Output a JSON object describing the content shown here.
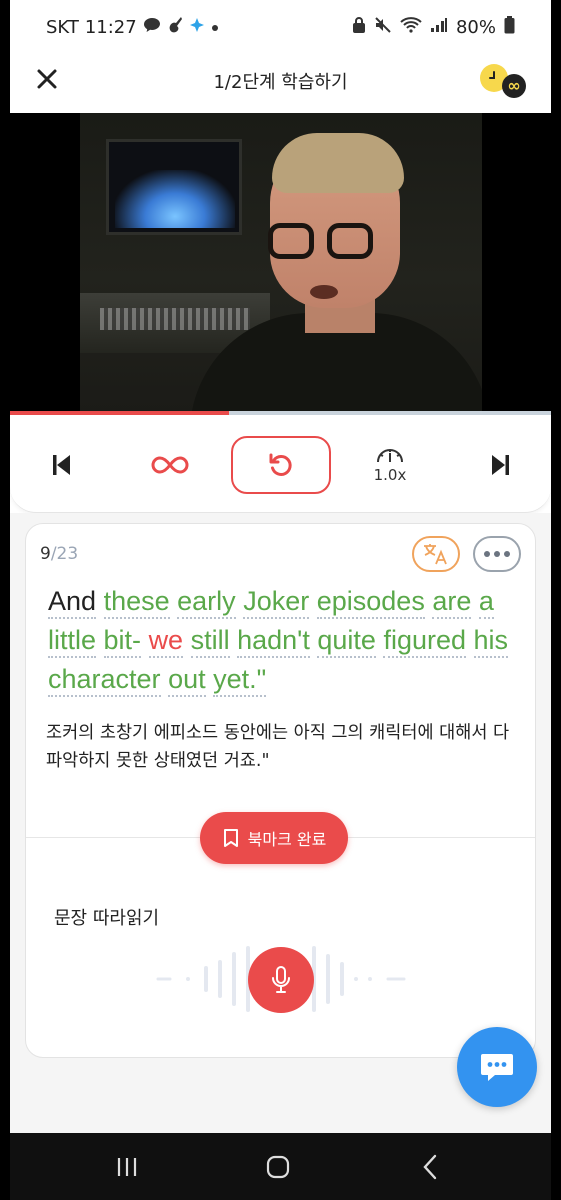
{
  "status_bar": {
    "carrier": "SKT",
    "time": "11:27",
    "battery": "80%"
  },
  "header": {
    "title": "1/2단계 학습하기"
  },
  "video": {
    "progress": 0.405
  },
  "controls": {
    "speed": "1.0x"
  },
  "sentence": {
    "counter_current": "9",
    "counter_total": "/23",
    "english_words": [
      {
        "text": "And",
        "color": "black"
      },
      {
        "text": "these",
        "color": "green"
      },
      {
        "text": "early",
        "color": "green"
      },
      {
        "text": "Joker",
        "color": "green"
      },
      {
        "text": "episodes",
        "color": "green"
      },
      {
        "text": "are",
        "color": "green"
      },
      {
        "text": "a",
        "color": "green"
      },
      {
        "text": "little",
        "color": "green"
      },
      {
        "text": "bit-",
        "color": "green"
      },
      {
        "text": "we",
        "color": "red"
      },
      {
        "text": "still",
        "color": "green"
      },
      {
        "text": "hadn't",
        "color": "green"
      },
      {
        "text": "quite",
        "color": "green"
      },
      {
        "text": "figured",
        "color": "green"
      },
      {
        "text": "his",
        "color": "green"
      },
      {
        "text": "character",
        "color": "green"
      },
      {
        "text": "out",
        "color": "green"
      },
      {
        "text": "yet.\"",
        "color": "green"
      }
    ],
    "korean": "조커의 초창기 에피소드 동안에는 아직 그의 캐릭터에 대해서 다 파악하지 못한 상태였던 거죠.\""
  },
  "bookmark": {
    "label": "북마크 완료"
  },
  "shadowing": {
    "label": "문장 따라읽기"
  },
  "colors": {
    "accent_red": "#ea4b4b",
    "correct_green": "#5aa84a",
    "chat_blue": "#3393f0",
    "translate_orange": "#f0a35c"
  },
  "icons": {
    "close": "close-icon",
    "prev": "skip-previous-icon",
    "loop": "infinity-loop-icon",
    "repeat": "replay-icon",
    "speed": "speedometer-icon",
    "next": "skip-next-icon",
    "translate": "translate-icon",
    "more": "more-icon",
    "bookmark": "bookmark-icon",
    "mic": "microphone-icon",
    "chat": "chat-icon"
  }
}
